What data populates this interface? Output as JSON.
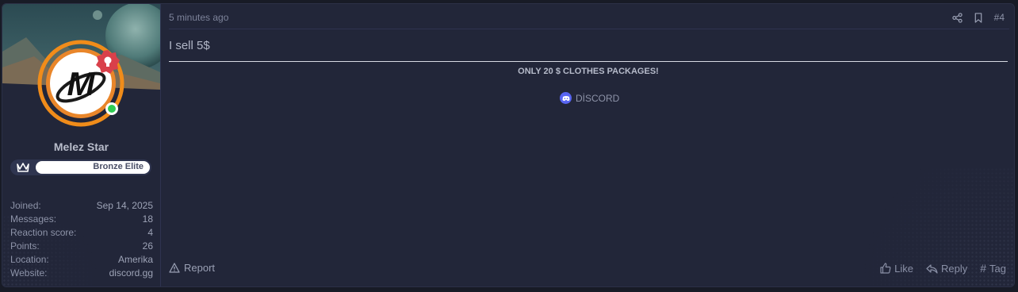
{
  "user": {
    "name": "Melez Star",
    "rank_label": "Bronze Elite",
    "avatar_letter": "M",
    "online": true,
    "stats": [
      {
        "key": "Joined:",
        "value": "Sep 14, 2025"
      },
      {
        "key": "Messages:",
        "value": "18"
      },
      {
        "key": "Reaction score:",
        "value": "4"
      },
      {
        "key": "Points:",
        "value": "26"
      },
      {
        "key": "Location:",
        "value": "Amerika"
      },
      {
        "key": "Website:",
        "value": "discord.gg"
      }
    ]
  },
  "post": {
    "time": "5 minutes ago",
    "number": "#4",
    "body": "I sell 5$",
    "bold_line": "ONLY 20 $ CLOTHES PACKAGES!",
    "discord_label": "DİSCORD"
  },
  "footer": {
    "report": "Report",
    "like": "Like",
    "reply": "Reply",
    "tag": "Tag"
  },
  "colors": {
    "accent_orange": "#f08c1a",
    "badge_red": "#d9404a",
    "online_green": "#2ecc52",
    "discord_blurple": "#5865f2"
  },
  "icons": [
    "share-icon",
    "bookmark-icon",
    "warning-icon",
    "thumbs-up-icon",
    "reply-icon",
    "hashtag-icon",
    "crown-icon",
    "lightbulb-icon",
    "discord-icon"
  ]
}
